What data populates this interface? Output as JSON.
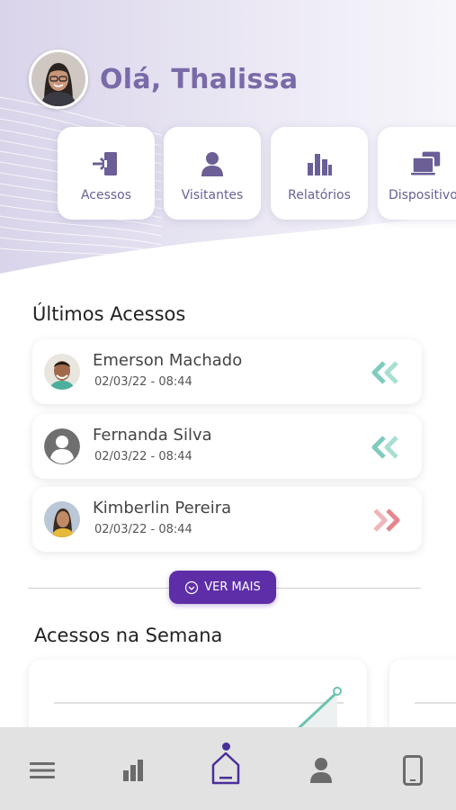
{
  "greeting": {
    "text": "Olá, Thalissa"
  },
  "quick_actions": [
    {
      "label": "Acessos",
      "icon": "login-door-icon"
    },
    {
      "label": "Visitantes",
      "icon": "person-icon"
    },
    {
      "label": "Relatórios",
      "icon": "bar-chart-icon"
    },
    {
      "label": "Dispositivos",
      "icon": "devices-icon"
    }
  ],
  "last_access": {
    "title": "Últimos Acessos",
    "items": [
      {
        "name": "Emerson Machado",
        "time": "02/03/22 - 08:44",
        "direction": "in",
        "direction_icon": "double-chevron-left-icon"
      },
      {
        "name": "Fernanda Silva",
        "time": "02/03/22 - 08:44",
        "direction": "in",
        "direction_icon": "double-chevron-left-icon"
      },
      {
        "name": "Kimberlin Pereira",
        "time": "02/03/22 - 08:44",
        "direction": "out",
        "direction_icon": "double-chevron-right-icon"
      }
    ],
    "more_button": "VER MAIS"
  },
  "weekly": {
    "title": "Acessos na Semana"
  },
  "bottom_nav": [
    {
      "icon": "menu-icon",
      "active": false
    },
    {
      "icon": "bar-chart-icon",
      "active": false
    },
    {
      "icon": "home-icon",
      "active": true
    },
    {
      "icon": "person-icon",
      "active": false
    },
    {
      "icon": "smartphone-icon",
      "active": false
    }
  ],
  "colors": {
    "brand_purple": "#5e2ea8",
    "accent_lavender": "#7a6aa8",
    "entry_teal": "#7fcbbd",
    "exit_pink": "#e5868f",
    "nav_bg": "#e2e2e2"
  }
}
